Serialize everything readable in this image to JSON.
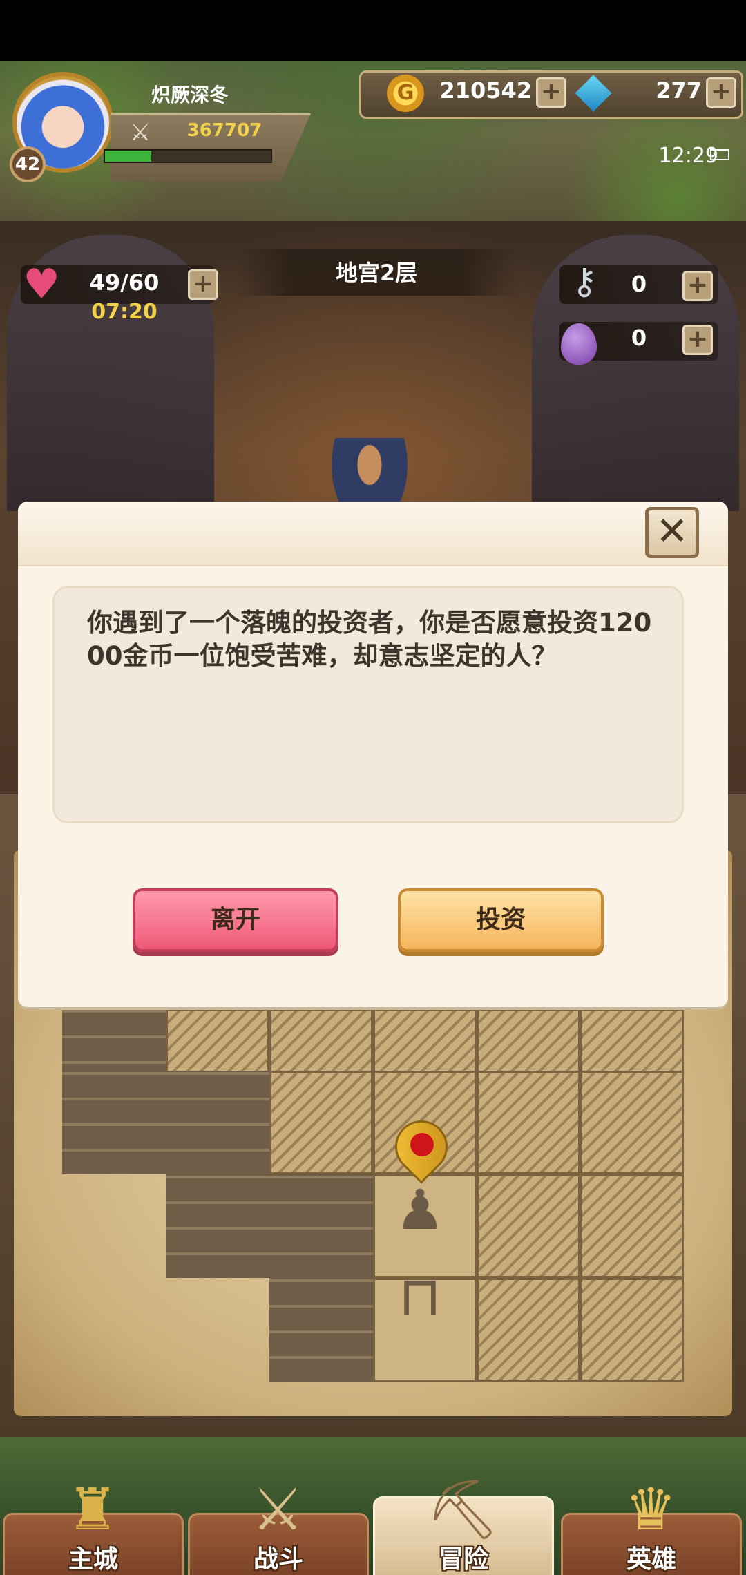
{
  "header": {
    "player_name": "炽厥深冬",
    "player_level": "42",
    "combat_power": "367707",
    "exp_fraction": 0.28,
    "gold": "210542",
    "gems": "277",
    "clock": "12:29"
  },
  "dungeon": {
    "floor_title": "地宫2层",
    "stamina": "49/60",
    "stamina_timer": "07:20",
    "keys": "0",
    "eggs": "0"
  },
  "dialog": {
    "close_glyph": "✕",
    "message": "你遇到了一个落魄的投资者，你是否愿意投资12000金币一位饱受苦难，却意志坚定的人？",
    "leave_label": "离开",
    "invest_label": "投资"
  },
  "nav": {
    "tabs": [
      {
        "label": "主城",
        "icon": "castle-icon"
      },
      {
        "label": "战斗",
        "icon": "crossed-swords-icon"
      },
      {
        "label": "冒险",
        "icon": "map-scroll-icon"
      },
      {
        "label": "英雄",
        "icon": "hero-helmet-icon"
      }
    ],
    "active_tab": 2
  },
  "colors": {
    "leave_button": "#ef5a78",
    "invest_button": "#f5b55c",
    "stamina_timer": "#f2d14a",
    "power_value": "#f2d14a"
  }
}
